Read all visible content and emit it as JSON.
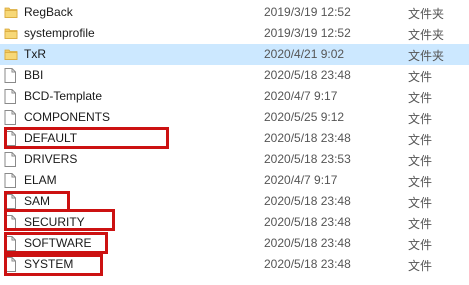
{
  "accent_highlight_color": "#cc1111",
  "folder_color": "#f2c960",
  "files": [
    {
      "name": "RegBack",
      "date": "2019/3/19 12:52",
      "type": "文件夹",
      "icon": "folder-icon",
      "highlighted": false
    },
    {
      "name": "systemprofile",
      "date": "2019/3/19 12:52",
      "type": "文件夹",
      "icon": "folder-icon",
      "highlighted": false
    },
    {
      "name": "TxR",
      "date": "2020/4/21 9:02",
      "type": "文件夹",
      "icon": "folder-icon",
      "highlighted": false,
      "selected": true
    },
    {
      "name": "BBI",
      "date": "2020/5/18 23:48",
      "type": "文件",
      "icon": "file-icon",
      "highlighted": false
    },
    {
      "name": "BCD-Template",
      "date": "2020/4/7 9:17",
      "type": "文件",
      "icon": "file-icon",
      "highlighted": false
    },
    {
      "name": "COMPONENTS",
      "date": "2020/5/25 9:12",
      "type": "文件",
      "icon": "file-icon",
      "highlighted": false
    },
    {
      "name": "DEFAULT",
      "date": "2020/5/18 23:48",
      "type": "文件",
      "icon": "file-icon",
      "highlighted": true
    },
    {
      "name": "DRIVERS",
      "date": "2020/5/18 23:53",
      "type": "文件",
      "icon": "file-icon",
      "highlighted": false
    },
    {
      "name": "ELAM",
      "date": "2020/4/7 9:17",
      "type": "文件",
      "icon": "file-icon",
      "highlighted": false
    },
    {
      "name": "SAM",
      "date": "2020/5/18 23:48",
      "type": "文件",
      "icon": "file-icon",
      "highlighted": true
    },
    {
      "name": "SECURITY",
      "date": "2020/5/18 23:48",
      "type": "文件",
      "icon": "file-icon",
      "highlighted": true
    },
    {
      "name": "SOFTWARE",
      "date": "2020/5/18 23:48",
      "type": "文件",
      "icon": "file-icon",
      "highlighted": true
    },
    {
      "name": "SYSTEM",
      "date": "2020/5/18 23:48",
      "type": "文件",
      "icon": "file-icon",
      "highlighted": true
    }
  ]
}
